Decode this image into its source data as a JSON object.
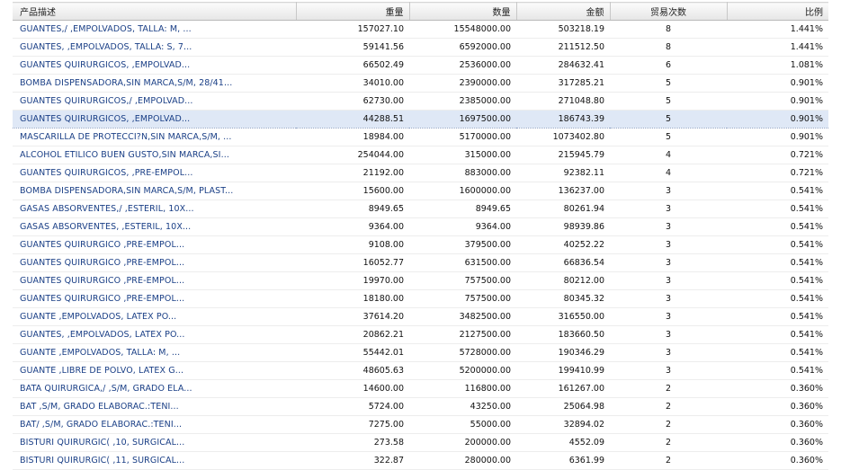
{
  "headers": {
    "desc": "产品描述",
    "weight": "重量",
    "quantity": "数量",
    "amount": "金额",
    "trades": "贸易次数",
    "ratio": "比例"
  },
  "selected_row": 5,
  "rows": [
    {
      "desc": "GUANTES,/ ,EMPOLVADOS, TALLA: M, ...",
      "weight": "157027.10",
      "quantity": "15548000.00",
      "amount": "503218.19",
      "trades": "8",
      "ratio": "1.441%"
    },
    {
      "desc": "GUANTES, ,EMPOLVADOS, TALLA: S, 7...",
      "weight": "59141.56",
      "quantity": "6592000.00",
      "amount": "211512.50",
      "trades": "8",
      "ratio": "1.441%"
    },
    {
      "desc": "GUANTES QUIRURGICOS, ,EMPOLVAD...",
      "weight": "66502.49",
      "quantity": "2536000.00",
      "amount": "284632.41",
      "trades": "6",
      "ratio": "1.081%"
    },
    {
      "desc": "BOMBA DISPENSADORA,SIN MARCA,S/M, 28/41...",
      "weight": "34010.00",
      "quantity": "2390000.00",
      "amount": "317285.21",
      "trades": "5",
      "ratio": "0.901%"
    },
    {
      "desc": "GUANTES QUIRURGICOS,/ ,EMPOLVAD...",
      "weight": "62730.00",
      "quantity": "2385000.00",
      "amount": "271048.80",
      "trades": "5",
      "ratio": "0.901%"
    },
    {
      "desc": "GUANTES QUIRURGICOS, ,EMPOLVAD...",
      "weight": "44288.51",
      "quantity": "1697500.00",
      "amount": "186743.39",
      "trades": "5",
      "ratio": "0.901%"
    },
    {
      "desc": "MASCARILLA DE PROTECCI?N,SIN MARCA,S/M, ...",
      "weight": "18984.00",
      "quantity": "5170000.00",
      "amount": "1073402.80",
      "trades": "5",
      "ratio": "0.901%"
    },
    {
      "desc": "ALCOHOL ETILICO BUEN GUSTO,SIN MARCA,SI...",
      "weight": "254044.00",
      "quantity": "315000.00",
      "amount": "215945.79",
      "trades": "4",
      "ratio": "0.721%"
    },
    {
      "desc": "GUANTES QUIRURGICOS, ,PRE-EMPOL...",
      "weight": "21192.00",
      "quantity": "883000.00",
      "amount": "92382.11",
      "trades": "4",
      "ratio": "0.721%"
    },
    {
      "desc": "BOMBA DISPENSADORA,SIN MARCA,S/M, PLAST...",
      "weight": "15600.00",
      "quantity": "1600000.00",
      "amount": "136237.00",
      "trades": "3",
      "ratio": "0.541%"
    },
    {
      "desc": "GASAS ABSORVENTES,/ ,ESTERIL, 10X...",
      "weight": "8949.65",
      "quantity": "8949.65",
      "amount": "80261.94",
      "trades": "3",
      "ratio": "0.541%"
    },
    {
      "desc": "GASAS ABSORVENTES, ,ESTERIL, 10X...",
      "weight": "9364.00",
      "quantity": "9364.00",
      "amount": "98939.86",
      "trades": "3",
      "ratio": "0.541%"
    },
    {
      "desc": "GUANTES QUIRURGICO ,PRE-EMPOL...",
      "weight": "9108.00",
      "quantity": "379500.00",
      "amount": "40252.22",
      "trades": "3",
      "ratio": "0.541%"
    },
    {
      "desc": "GUANTES QUIRURGICO ,PRE-EMPOL...",
      "weight": "16052.77",
      "quantity": "631500.00",
      "amount": "66836.54",
      "trades": "3",
      "ratio": "0.541%"
    },
    {
      "desc": "GUANTES QUIRURGICO ,PRE-EMPOL...",
      "weight": "19970.00",
      "quantity": "757500.00",
      "amount": "80212.00",
      "trades": "3",
      "ratio": "0.541%"
    },
    {
      "desc": "GUANTES QUIRURGICO ,PRE-EMPOL...",
      "weight": "18180.00",
      "quantity": "757500.00",
      "amount": "80345.32",
      "trades": "3",
      "ratio": "0.541%"
    },
    {
      "desc": "GUANTE ,EMPOLVADOS, LATEX PO...",
      "weight": "37614.20",
      "quantity": "3482500.00",
      "amount": "316550.00",
      "trades": "3",
      "ratio": "0.541%"
    },
    {
      "desc": "GUANTES, ,EMPOLVADOS, LATEX PO...",
      "weight": "20862.21",
      "quantity": "2127500.00",
      "amount": "183660.50",
      "trades": "3",
      "ratio": "0.541%"
    },
    {
      "desc": "GUANTE ,EMPOLVADOS, TALLA: M, ...",
      "weight": "55442.01",
      "quantity": "5728000.00",
      "amount": "190346.29",
      "trades": "3",
      "ratio": "0.541%"
    },
    {
      "desc": "GUANTE ,LIBRE DE POLVO, LATEX G...",
      "weight": "48605.63",
      "quantity": "5200000.00",
      "amount": "199410.99",
      "trades": "3",
      "ratio": "0.541%"
    },
    {
      "desc": "BATA QUIRURGICA,/ ,S/M, GRADO ELA...",
      "weight": "14600.00",
      "quantity": "116800.00",
      "amount": "161267.00",
      "trades": "2",
      "ratio": "0.360%"
    },
    {
      "desc": "BAT ,S/M, GRADO ELABORAC.:TENI...",
      "weight": "5724.00",
      "quantity": "43250.00",
      "amount": "25064.98",
      "trades": "2",
      "ratio": "0.360%"
    },
    {
      "desc": "BAT/ ,S/M, GRADO ELABORAC.:TENI...",
      "weight": "7275.00",
      "quantity": "55000.00",
      "amount": "32894.02",
      "trades": "2",
      "ratio": "0.360%"
    },
    {
      "desc": "BISTURI QUIRURGIC( ,10, SURGICAL...",
      "weight": "273.58",
      "quantity": "200000.00",
      "amount": "4552.09",
      "trades": "2",
      "ratio": "0.360%"
    },
    {
      "desc": "BISTURI QUIRURGIC( ,11, SURGICAL...",
      "weight": "322.87",
      "quantity": "280000.00",
      "amount": "6361.99",
      "trades": "2",
      "ratio": "0.360%"
    }
  ]
}
